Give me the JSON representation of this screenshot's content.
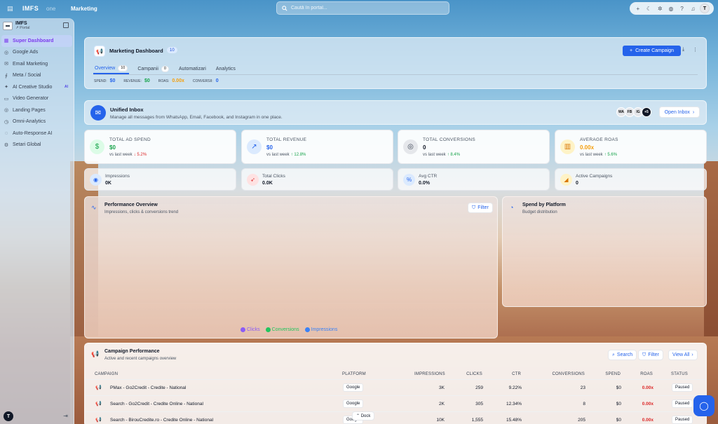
{
  "topbar": {
    "brand": "IMFS",
    "brand_suffix": "one",
    "breadcrumb": "Marketing",
    "search_placeholder": "Caută în portal..."
  },
  "sidebar": {
    "name": "IMFS",
    "subtitle": "↗ Portal",
    "user_initial": "T",
    "items": [
      {
        "label": "Super Dashboard",
        "icon": "grid-icon",
        "active": true
      },
      {
        "label": "Google Ads",
        "icon": "globe-icon"
      },
      {
        "label": "Email Marketing",
        "icon": "mail-icon"
      },
      {
        "label": "Meta / Social",
        "icon": "meta-icon"
      },
      {
        "label": "AI Creative Studio",
        "icon": "sparkle-icon",
        "badge": "AI"
      },
      {
        "label": "Video Generator",
        "icon": "video-icon"
      },
      {
        "label": "Landing Pages",
        "icon": "globe-icon"
      },
      {
        "label": "Omni-Analytics",
        "icon": "chart-icon"
      },
      {
        "label": "Auto-Response AI",
        "icon": "chat-icon"
      },
      {
        "label": "Setari Global",
        "icon": "gear-icon"
      }
    ]
  },
  "dashboard": {
    "title": "Marketing Dashboard",
    "count": "10",
    "create_label": "Create Campaign",
    "tabs": [
      {
        "label": "Overview",
        "count": "10",
        "active": true
      },
      {
        "label": "Campanii",
        "count": "0"
      },
      {
        "label": "Automatizari"
      },
      {
        "label": "Analytics"
      }
    ],
    "kpis": [
      {
        "label": "SPEND:",
        "value": "$0",
        "color": "#2563eb"
      },
      {
        "label": "REVENUE:",
        "value": "$0",
        "color": "#16a34a"
      },
      {
        "label": "ROAS:",
        "value": "0.00x",
        "color": "#f59e0b"
      },
      {
        "label": "CONVERSII:",
        "value": "0",
        "color": "#2563eb"
      }
    ]
  },
  "inbox": {
    "title": "Unified Inbox",
    "subtitle": "Manage all messages from WhatsApp, Email, Facebook, and Instagram in one place.",
    "avatars": [
      "WA",
      "FB",
      "IG",
      "+5"
    ],
    "button": "Open Inbox"
  },
  "stats": [
    {
      "label": "TOTAL AD SPEND",
      "value": "$0",
      "trend_prefix": "vs last week",
      "trend": "↓ 5.2%",
      "dir": "down",
      "icon": "$",
      "value_color": "#16a34a",
      "icon_bg": "#dcfce7",
      "icon_color": "#16a34a"
    },
    {
      "label": "TOTAL REVENUE",
      "value": "$0",
      "trend_prefix": "vs last week",
      "trend": "↑ 12.8%",
      "dir": "up",
      "icon": "↗",
      "value_color": "#2563eb",
      "icon_bg": "#dbeafe",
      "icon_color": "#2563eb"
    },
    {
      "label": "TOTAL CONVERSIONS",
      "value": "0",
      "trend_prefix": "vs last week",
      "trend": "↑ 8.4%",
      "dir": "up",
      "icon": "◎",
      "value_color": "#111827",
      "icon_bg": "#e5e7eb",
      "icon_color": "#374151"
    },
    {
      "label": "AVERAGE ROAS",
      "value": "0.00x",
      "trend_prefix": "vs last week",
      "trend": "↑ 5.6%",
      "dir": "up",
      "icon": "▥",
      "value_color": "#f59e0b",
      "icon_bg": "#fef3c7",
      "icon_color": "#d97706"
    }
  ],
  "minis": [
    {
      "label": "Impressions",
      "value": "0K",
      "icon": "◉",
      "icon_bg": "#dbeafe",
      "icon_color": "#2563eb"
    },
    {
      "label": "Total Clicks",
      "value": "0.0K",
      "icon": "➶",
      "icon_bg": "#fee2e2",
      "icon_color": "#dc2626"
    },
    {
      "label": "Avg CTR",
      "value": "0.0%",
      "icon": "%",
      "icon_bg": "#dbeafe",
      "icon_color": "#2563eb"
    },
    {
      "label": "Active Campaigns",
      "value": "0",
      "icon": "◢",
      "icon_bg": "#fef3c7",
      "icon_color": "#d97706"
    }
  ],
  "perf": {
    "title": "Performance Overview",
    "subtitle": "Impressions, clicks & conversions trend",
    "filter": "Filter",
    "legend": [
      {
        "label": "Clicks",
        "color": "#8b5cf6"
      },
      {
        "label": "Conversions",
        "color": "#22c55e"
      },
      {
        "label": "Impressions",
        "color": "#3b82f6"
      }
    ]
  },
  "spend": {
    "title": "Spend by Platform",
    "subtitle": "Budget distribution"
  },
  "campaigns": {
    "title": "Campaign Performance",
    "subtitle": "Active and recent campaigns overview",
    "search": "Search",
    "filter": "Filter",
    "view_all": "View All",
    "headers": [
      "CAMPAIGN",
      "PLATFORM",
      "IMPRESSIONS",
      "CLICKS",
      "CTR",
      "CONVERSIONS",
      "SPEND",
      "ROAS",
      "STATUS"
    ],
    "rows": [
      {
        "campaign": "PMax - Go2Credit - Credite - National",
        "platform": "Google",
        "impressions": "3K",
        "clicks": "259",
        "ctr": "9.22%",
        "conversions": "23",
        "spend": "$0",
        "roas": "0.00x",
        "status": "Paused"
      },
      {
        "campaign": "Search - Go2Credit - Credite Online - National",
        "platform": "Google",
        "impressions": "2K",
        "clicks": "305",
        "ctr": "12.34%",
        "conversions": "8",
        "spend": "$0",
        "roas": "0.00x",
        "status": "Paused"
      },
      {
        "campaign": "Search - BirouCredite.ro - Credite Online - National",
        "platform": "Google",
        "impressions": "10K",
        "clicks": "1,555",
        "ctr": "15.48%",
        "conversions": "205",
        "spend": "$0",
        "roas": "0.00x",
        "status": "Paused"
      }
    ]
  },
  "dock": "⌃ Dock"
}
